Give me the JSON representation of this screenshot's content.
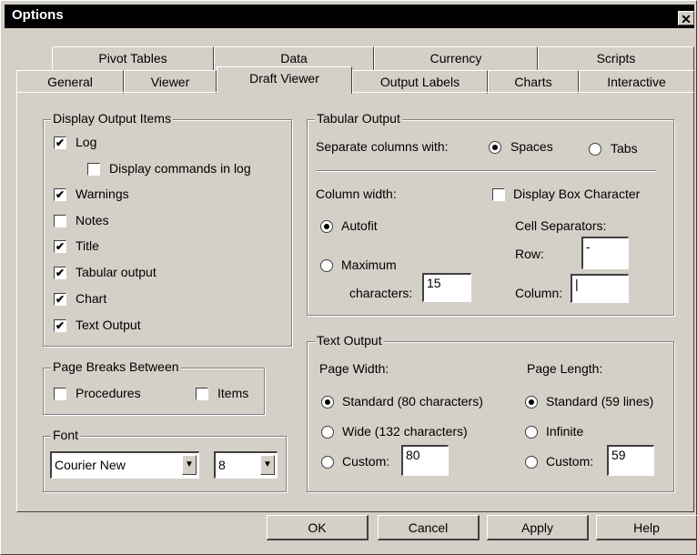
{
  "window": {
    "title": "Options",
    "close_glyph": "✕"
  },
  "tabs_back": [
    {
      "label": "Pivot Tables"
    },
    {
      "label": "Data"
    },
    {
      "label": "Currency"
    },
    {
      "label": "Scripts"
    }
  ],
  "tabs_front": [
    {
      "label": "General"
    },
    {
      "label": "Viewer"
    },
    {
      "label": "Draft Viewer",
      "active": true
    },
    {
      "label": "Output Labels"
    },
    {
      "label": "Charts"
    },
    {
      "label": "Interactive"
    }
  ],
  "display_output_items": {
    "legend": "Display Output Items",
    "items": [
      {
        "label": "Log",
        "checked": true
      },
      {
        "label": "Display commands in log",
        "checked": false
      },
      {
        "label": "Warnings",
        "checked": true
      },
      {
        "label": "Notes",
        "checked": false
      },
      {
        "label": "Title",
        "checked": true
      },
      {
        "label": "Tabular output",
        "checked": true
      },
      {
        "label": "Chart",
        "checked": true
      },
      {
        "label": "Text Output",
        "checked": true
      }
    ]
  },
  "page_breaks": {
    "legend": "Page Breaks Between",
    "procedures": {
      "label": "Procedures",
      "checked": false
    },
    "items": {
      "label": "Items",
      "checked": false
    }
  },
  "font": {
    "legend": "Font",
    "family": "Courier New",
    "size": "8",
    "dropdown_glyph": "▼"
  },
  "tabular_output": {
    "legend": "Tabular Output",
    "separate_label": "Separate columns with:",
    "spaces_label": "Spaces",
    "tabs_label": "Tabs",
    "separator_selected": "Spaces",
    "column_width_label": "Column width:",
    "autofit_label": "Autofit",
    "maximum_label": "Maximum",
    "characters_label": "characters:",
    "max_characters": "15",
    "width_selected": "Autofit",
    "display_box_label": "Display Box Character",
    "display_box_checked": false,
    "cell_separators_label": "Cell Separators:",
    "row_label": "Row:",
    "row_value": "-",
    "column_label": "Column:",
    "column_value": "|"
  },
  "text_output": {
    "legend": "Text Output",
    "page_width_label": "Page Width:",
    "width_standard": "Standard (80 characters)",
    "width_wide": "Wide (132  characters)",
    "width_custom": "Custom:",
    "width_custom_value": "80",
    "width_selected": "standard",
    "page_length_label": "Page Length:",
    "length_standard": "Standard (59 lines)",
    "length_infinite": "Infinite",
    "length_custom": "Custom:",
    "length_custom_value": "59",
    "length_selected": "standard"
  },
  "buttons": {
    "ok": "OK",
    "cancel": "Cancel",
    "apply": "Apply",
    "help": "Help"
  },
  "check_glyph": "✔"
}
